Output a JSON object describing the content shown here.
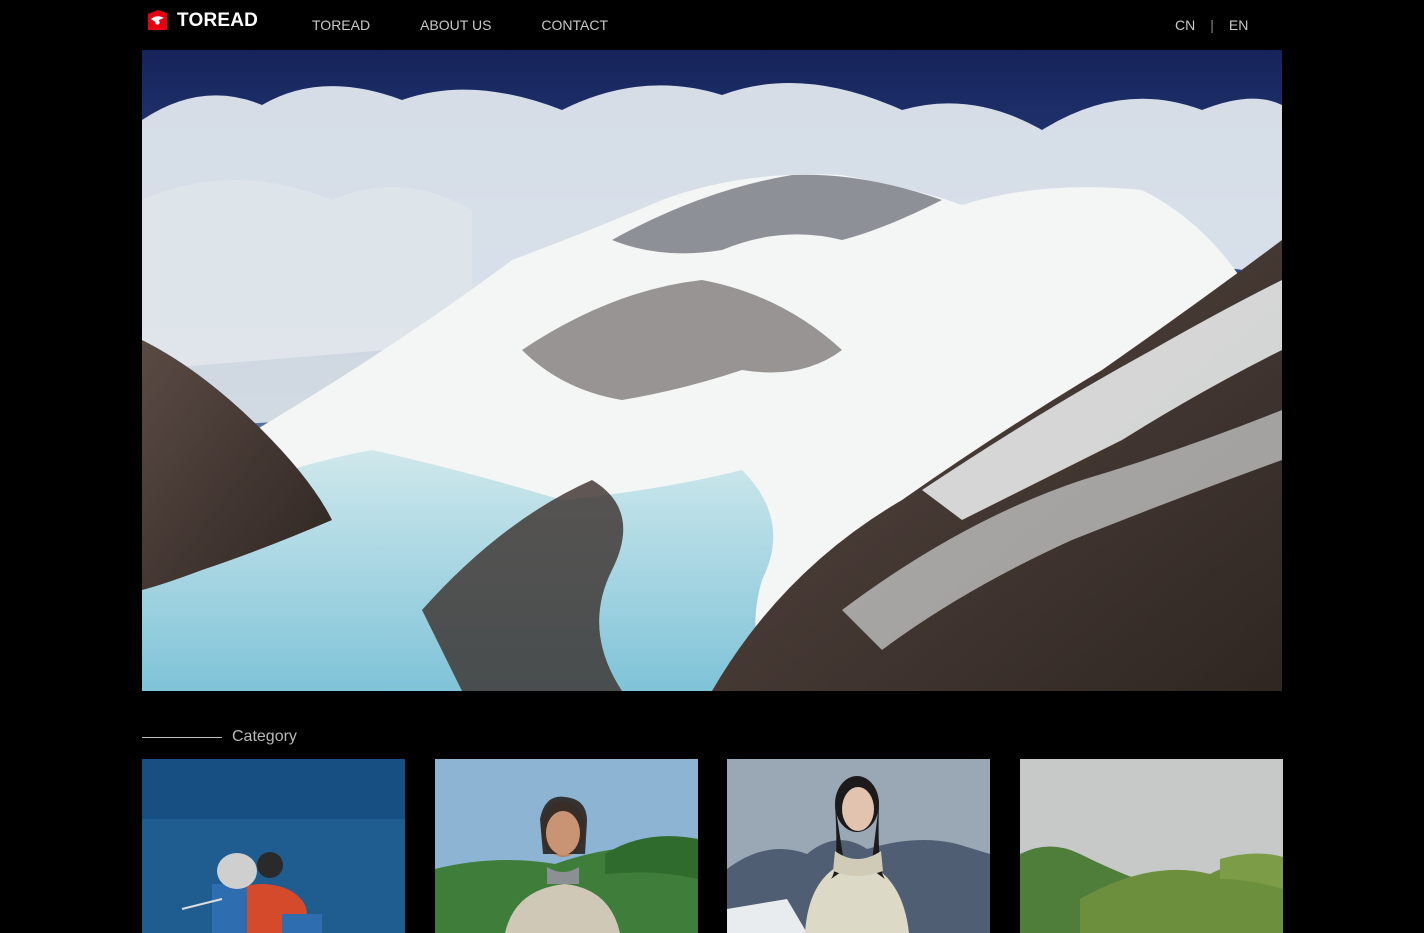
{
  "header": {
    "logo_text": "TOREAD",
    "brand_color": "#e60012",
    "nav": [
      {
        "label": "TOREAD"
      },
      {
        "label": "ABOUT US"
      },
      {
        "label": "CONTACT"
      }
    ],
    "lang": {
      "cn": "CN",
      "separator": "|",
      "en": "EN"
    }
  },
  "hero": {
    "image": "snow-mountain-glacier-photo"
  },
  "category": {
    "title": "Category",
    "cards": [
      {
        "image": "climber-blue-sky-photo"
      },
      {
        "image": "woman-braids-hills-photo"
      },
      {
        "image": "woman-down-jacket-mountains-photo"
      },
      {
        "image": "green-hills-photo"
      }
    ]
  }
}
